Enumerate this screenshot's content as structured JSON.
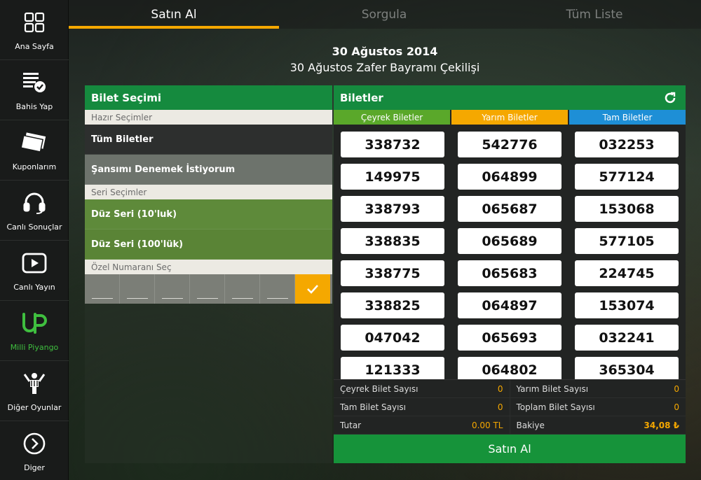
{
  "sidebar": {
    "items": [
      {
        "label": "Ana Sayfa",
        "icon": "home-grid-icon"
      },
      {
        "label": "Bahis Yap",
        "icon": "bet-slip-icon"
      },
      {
        "label": "Kuponlarım",
        "icon": "coupons-icon"
      },
      {
        "label": "Canlı Sonuçlar",
        "icon": "headset-icon"
      },
      {
        "label": "Canlı Yayın",
        "icon": "play-icon"
      },
      {
        "label": "Milli Piyango",
        "icon": "milli-piyango-icon"
      },
      {
        "label": "Diğer Oyunlar",
        "icon": "other-games-icon"
      },
      {
        "label": "Diger",
        "icon": "chevron-right-icon"
      }
    ],
    "active_color": "#3fbf3f"
  },
  "tabs": [
    {
      "label": "Satın Al"
    },
    {
      "label": "Sorgula"
    },
    {
      "label": "Tüm Liste"
    }
  ],
  "header": {
    "date": "30 Ağustos 2014",
    "draw_name": "30 Ağustos Zafer Bayramı Çekilişi"
  },
  "left_panel": {
    "title": "Bilet Seçimi",
    "ready_section": "Hazır Seçimler",
    "all_tickets": "Tüm Biletler",
    "try_luck": "Şansımı Denemek İstiyorum",
    "series_section": "Seri Seçimler",
    "series_10": "Düz Seri (10'luk)",
    "series_100": "Düz Seri (100'lük)",
    "custom_section": "Özel Numaranı Seç"
  },
  "right_panel": {
    "title": "Biletler",
    "categories": [
      {
        "label": "Çeyrek Biletler",
        "color": "#5aa82a"
      },
      {
        "label": "Yarım Biletler",
        "color": "#f5a800"
      },
      {
        "label": "Tam Biletler",
        "color": "#1e8fd6"
      }
    ],
    "quarter": [
      "338732",
      "149975",
      "338793",
      "338835",
      "338775",
      "338825",
      "047042",
      "121333"
    ],
    "half": [
      "542776",
      "064899",
      "065687",
      "065689",
      "065683",
      "064897",
      "065693",
      "064802"
    ],
    "full": [
      "032253",
      "577124",
      "153068",
      "577105",
      "224745",
      "153074",
      "032241",
      "365304"
    ]
  },
  "summary": {
    "quarter_count_label": "Çeyrek Bilet Sayısı",
    "quarter_count": "0",
    "half_count_label": "Yarım Bilet Sayısı",
    "half_count": "0",
    "full_count_label": "Tam Bilet Sayısı",
    "full_count": "0",
    "total_count_label": "Toplam Bilet Sayısı",
    "total_count": "0",
    "amount_label": "Tutar",
    "amount": "0.00 TL",
    "balance_label": "Bakiye",
    "balance": "34,08 ₺"
  },
  "buy_button": "Satın Al",
  "colors": {
    "brand_green": "#158a3e",
    "accent_orange": "#f5a800",
    "blue": "#1e8fd6"
  }
}
